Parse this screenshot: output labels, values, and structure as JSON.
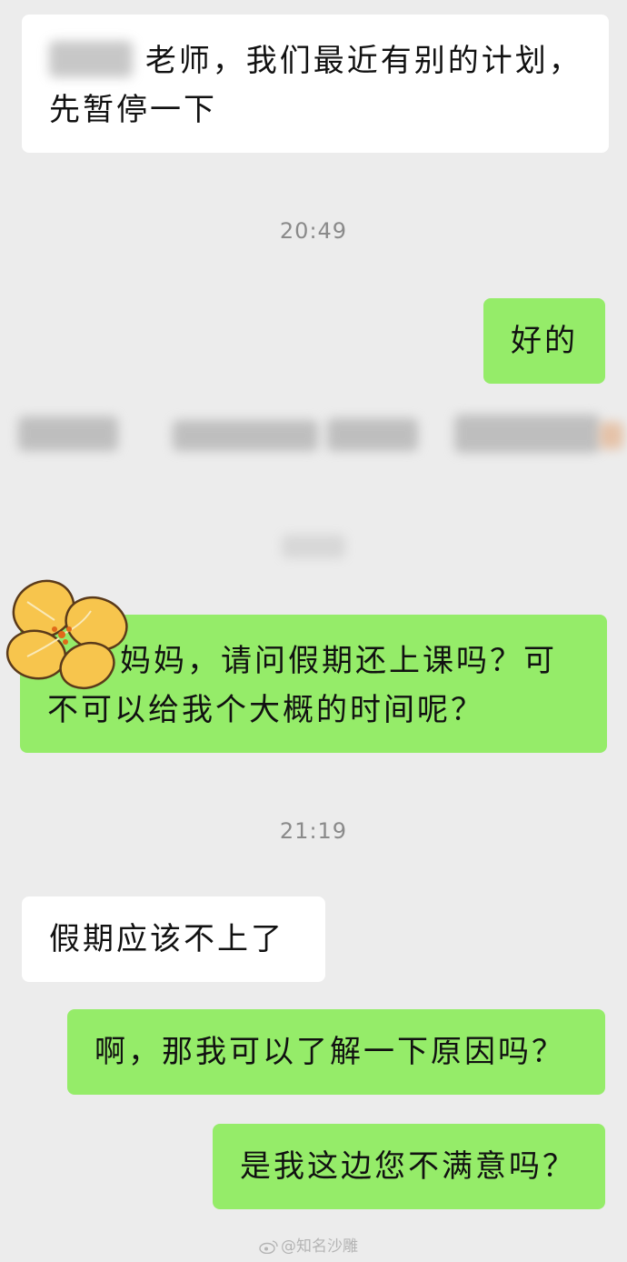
{
  "messages": [
    {
      "id": "m1",
      "side": "in",
      "text_line1": "老师，我们最近有别的计划，",
      "text_line2": "先暂停一下"
    },
    {
      "id": "m2",
      "side": "out",
      "text": "好的"
    },
    {
      "id": "m3",
      "side": "out",
      "text_line1": "妈妈，请问假期还上课吗？可",
      "text_line2": "不可以给我个大概的时间呢？"
    },
    {
      "id": "m4",
      "side": "in",
      "text": "假期应该不上了"
    },
    {
      "id": "m5",
      "side": "out",
      "text": "啊，那我可以了解一下原因吗？"
    },
    {
      "id": "m6",
      "side": "out",
      "text": "是我这边您不满意吗？"
    }
  ],
  "timestamps": [
    "20:49",
    "21:19"
  ],
  "watermark": "@知名沙雕",
  "colors": {
    "background": "#ececec",
    "incoming": "#ffffff",
    "outgoing": "#95ec69",
    "flower": "#f7c54d"
  }
}
